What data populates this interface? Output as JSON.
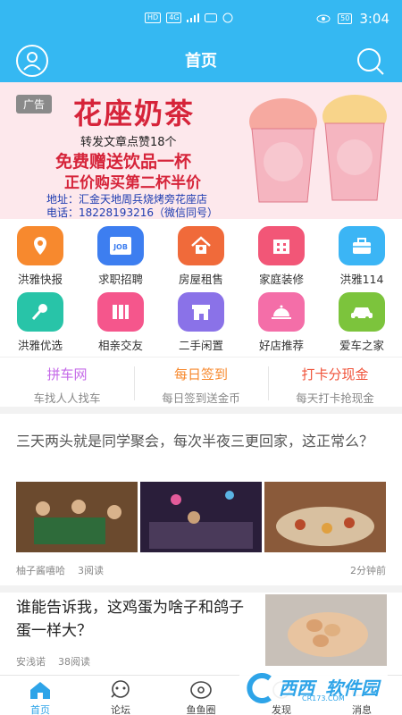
{
  "status_bar": {
    "network": "HD",
    "signal_label": "4G",
    "battery": "50",
    "time": "3:04"
  },
  "header": {
    "title": "首页"
  },
  "banner": {
    "tag": "广告",
    "shop_name": "花座奶茶",
    "line1": "转发文章点赞18个",
    "line2": "免费赠送饮品一杯",
    "line3": "正价购买第二杯半价",
    "address": "地址：汇金天地周兵烧烤旁花座店",
    "phone": "电话：18228193216（微信同号）"
  },
  "grid": [
    {
      "label": "洪雅快报",
      "color": "#f7892e",
      "icon": "location-pin-icon"
    },
    {
      "label": "求职招聘",
      "color": "#3d7ef0",
      "icon": "job-icon"
    },
    {
      "label": "房屋租售",
      "color": "#f06a3a",
      "icon": "house-icon"
    },
    {
      "label": "家庭装修",
      "color": "#f25677",
      "icon": "building-icon"
    },
    {
      "label": "洪雅114",
      "color": "#3bb5f5",
      "icon": "toolbox-icon"
    },
    {
      "label": "洪雅优选",
      "color": "#28c4a8",
      "icon": "microphone-icon"
    },
    {
      "label": "相亲交友",
      "color": "#f5568c",
      "icon": "books-icon"
    },
    {
      "label": "二手闲置",
      "color": "#8a72e8",
      "icon": "shop-icon"
    },
    {
      "label": "好店推荐",
      "color": "#f46ea8",
      "icon": "food-cloche-icon"
    },
    {
      "label": "爱车之家",
      "color": "#7cc43c",
      "icon": "car-icon"
    }
  ],
  "strip": [
    {
      "title": "拼车网",
      "sub": "车找人人找车",
      "color": "#c56ae8"
    },
    {
      "title": "每日签到",
      "sub": "每日签到送金币",
      "color": "#f7892e"
    },
    {
      "title": "打卡分现金",
      "sub": "每天打卡抢现金",
      "color": "#f0533a"
    }
  ],
  "article1": {
    "title": "三天两头就是同学聚会，每次半夜三更回家，这正常么？",
    "author": "柚子酱嘻哈",
    "reads": "3阅读",
    "time": "2分钟前"
  },
  "article2": {
    "title": "谁能告诉我，这鸡蛋为啥子和鸽子蛋一样大？",
    "author": "安浅诺",
    "reads": "38阅读"
  },
  "tabs": [
    {
      "label": "首页",
      "icon": "home-icon"
    },
    {
      "label": "论坛",
      "icon": "forum-icon"
    },
    {
      "label": "鱼鱼圈",
      "icon": "circle-icon"
    },
    {
      "label": "发现",
      "icon": "discover-icon"
    },
    {
      "label": "消息",
      "icon": "message-icon"
    }
  ],
  "watermark": {
    "t1": "西西",
    "t2": "软件园",
    "t3": "CR173.COM"
  },
  "colors": {
    "primary": "#35b8f2",
    "active_tab": "#2ea4e8"
  }
}
